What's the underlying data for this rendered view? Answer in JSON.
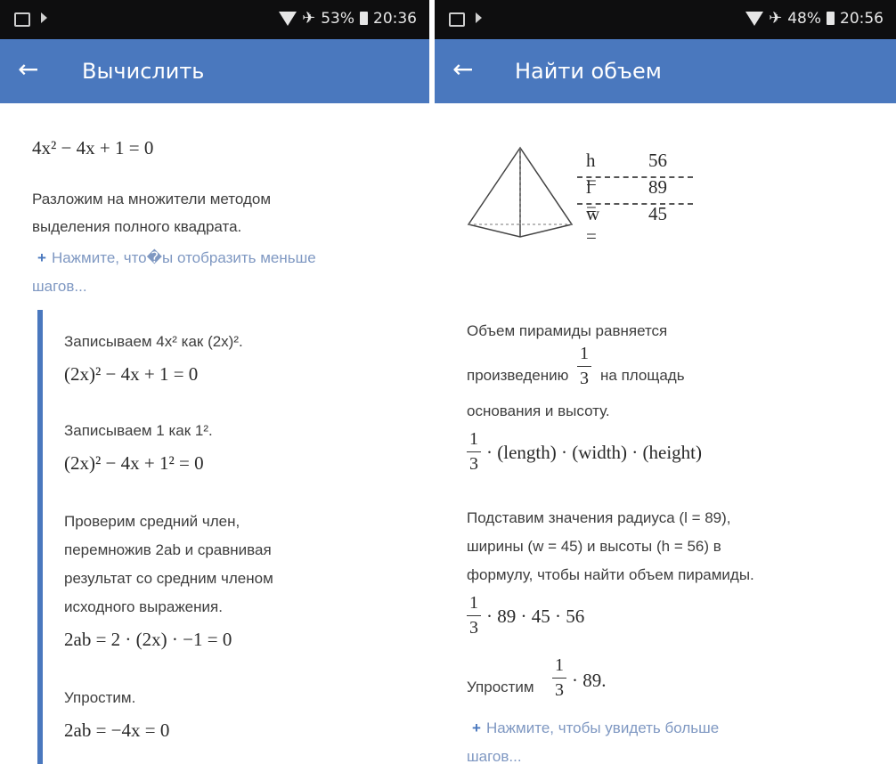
{
  "left": {
    "status": {
      "battery": "53%",
      "time": "20:36"
    },
    "app_title": "Вычислить",
    "equation": "4x² − 4x + 1 = 0",
    "intro": [
      "Разложим на множители методом",
      "выделения полного квадрата."
    ],
    "expand_link": "Нажмите, что�ы отобразить меньше",
    "expand_link_2": "шагов...",
    "steps": {
      "s1_text": "Записываем 4x² как (2x)².",
      "s1_math": "(2x)² − 4x + 1 = 0",
      "s2_text": "Записываем 1 как 1².",
      "s2_math": "(2x)² − 4x + 1² = 0",
      "s3_lines": [
        "Проверим средний член,",
        "перемножив 2ab и сравнивая",
        "результат со средним членом",
        "исходного выражения."
      ],
      "s3_math": "2ab = 2 · (2x) · −1 = 0",
      "s4_text": "Упростим.",
      "s4_math": "2ab = −4x = 0"
    }
  },
  "right": {
    "status": {
      "battery": "48%",
      "time": "20:56"
    },
    "app_title": "Найти объем",
    "dims": [
      {
        "label": "h =",
        "value": "56"
      },
      {
        "label": "l =",
        "value": "89"
      },
      {
        "label": "w =",
        "value": "45"
      }
    ],
    "para1_a": "Объем пирамиды равняется",
    "para1_b": "произведению",
    "para1_c": "на площадь",
    "para1_d": "основания и высоту.",
    "formula": "· (length) · (width) · (height)",
    "para2": [
      "Подставим значения радиуса (l = 89),",
      "ширины (w = 45) и высоты (h = 56) в",
      "формулу, чтобы найти объем пирамиды."
    ],
    "calc": "· 89 · 45 · 56",
    "simplify_a": "Упростим",
    "simplify_b": "· 89.",
    "more_link": "Нажмите, чтобы увидеть больше",
    "more_link_2": "шагов...",
    "frac_num": "1",
    "frac_den": "3"
  }
}
